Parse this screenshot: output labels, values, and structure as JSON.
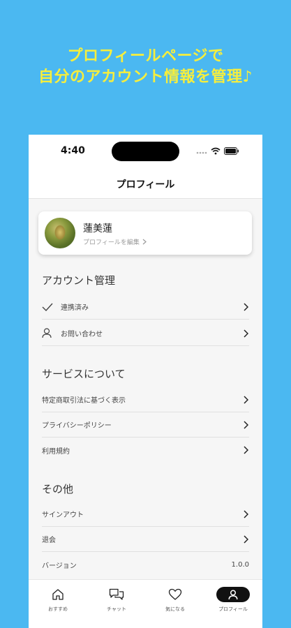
{
  "headline": {
    "line1": "プロフィールページで",
    "line2": "自分のアカウント情報を管理♪"
  },
  "colors": {
    "background": "#4bb8f1",
    "headline": "#f6ee3d",
    "active_tab": "#111111"
  },
  "status_bar": {
    "time": "4:40",
    "icons": [
      "signal-icon",
      "wifi-icon",
      "battery-icon"
    ]
  },
  "nav": {
    "title": "プロフィール"
  },
  "profile": {
    "name": "蓮美蓮",
    "edit_label": "プロフィールを編集"
  },
  "sections": {
    "account": {
      "title": "アカウント管理",
      "items": [
        {
          "label": "連携済み",
          "icon": "checkmark-icon"
        },
        {
          "label": "お問い合わせ",
          "icon": "person-icon"
        }
      ]
    },
    "service": {
      "title": "サービスについて",
      "items": [
        {
          "label": "特定商取引法に基づく表示"
        },
        {
          "label": "プライバシーポリシー"
        },
        {
          "label": "利用規約"
        }
      ]
    },
    "other": {
      "title": "その他",
      "items": [
        {
          "label": "サインアウト"
        },
        {
          "label": "退会"
        },
        {
          "label": "バージョン",
          "value": "1.0.0"
        }
      ]
    }
  },
  "tabs": [
    {
      "label": "おすすめ",
      "icon": "home-icon",
      "active": false
    },
    {
      "label": "チャット",
      "icon": "chat-icon",
      "active": false
    },
    {
      "label": "気になる",
      "icon": "heart-icon",
      "active": false
    },
    {
      "label": "プロフィール",
      "icon": "person-icon",
      "active": true
    }
  ]
}
